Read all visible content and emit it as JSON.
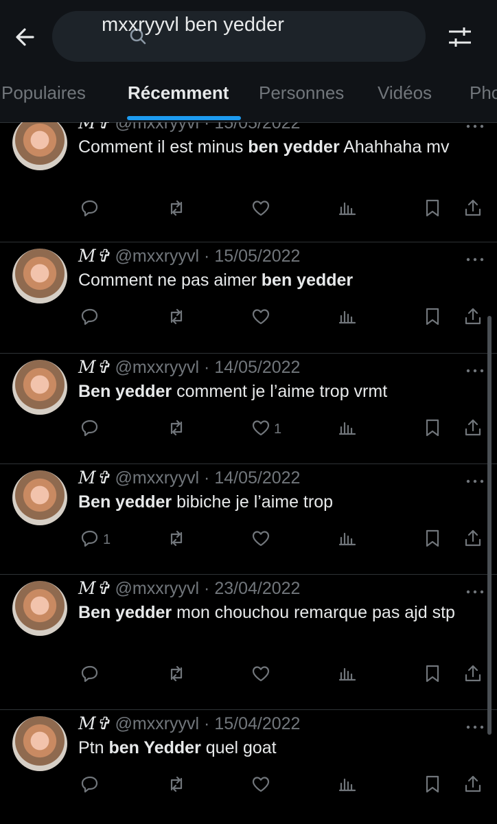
{
  "search": {
    "query": "mxxryyvl ben yedder"
  },
  "tabs": [
    {
      "label": "Populaires",
      "active": false
    },
    {
      "label": "Récemment",
      "active": true
    },
    {
      "label": "Personnes",
      "active": false
    },
    {
      "label": "Vidéos",
      "active": false
    },
    {
      "label": "Pho",
      "active": false
    }
  ],
  "colors": {
    "accent": "#1d9bf0",
    "background": "#000000",
    "topbar": "#101317",
    "muted": "#71767b"
  },
  "tweets": [
    {
      "name": "M✞",
      "handle": "@mxxryyvl",
      "date": "15/05/2022",
      "text": [
        {
          "t": "Comment il est minus "
        },
        {
          "t": "ben yedder",
          "b": true
        },
        {
          "t": " Ahahhaha mv"
        }
      ],
      "replies": "",
      "likes": ""
    },
    {
      "name": "M✞",
      "handle": "@mxxryyvl",
      "date": "15/05/2022",
      "text": [
        {
          "t": "Comment ne pas aimer "
        },
        {
          "t": "ben yedder",
          "b": true
        }
      ],
      "replies": "",
      "likes": ""
    },
    {
      "name": "M✞",
      "handle": "@mxxryyvl",
      "date": "14/05/2022",
      "text": [
        {
          "t": "Ben yedder",
          "b": true
        },
        {
          "t": " comment je l’aime trop vrmt"
        }
      ],
      "replies": "",
      "likes": "1"
    },
    {
      "name": "M✞",
      "handle": "@mxxryyvl",
      "date": "14/05/2022",
      "text": [
        {
          "t": "Ben yedder",
          "b": true
        },
        {
          "t": " bibiche je l’aime trop"
        }
      ],
      "replies": "1",
      "likes": ""
    },
    {
      "name": "M✞",
      "handle": "@mxxryyvl",
      "date": "23/04/2022",
      "text": [
        {
          "t": "Ben yedder",
          "b": true
        },
        {
          "t": " mon chouchou remarque pas ajd stp"
        }
      ],
      "replies": "",
      "likes": ""
    },
    {
      "name": "M✞",
      "handle": "@mxxryyvl",
      "date": "15/04/2022",
      "text": [
        {
          "t": "Ptn "
        },
        {
          "t": "ben Yedder",
          "b": true
        },
        {
          "t": " quel goat"
        }
      ],
      "replies": "",
      "likes": ""
    }
  ]
}
